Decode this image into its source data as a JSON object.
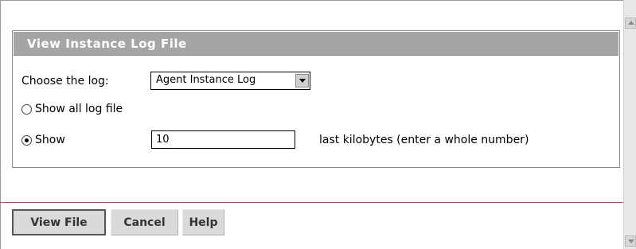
{
  "panel": {
    "title": "View Instance Log File"
  },
  "log_select": {
    "label": "Choose the log:",
    "value": "Agent Instance Log"
  },
  "options": {
    "show_all_label": "Show all log file",
    "show_all_selected": false,
    "show_last_label": "Show",
    "show_last_selected": true,
    "kilobytes_value": "10",
    "kilobytes_hint": "last kilobytes (enter a whole number)"
  },
  "buttons": {
    "view_file": "View File",
    "cancel": "Cancel",
    "help": "Help"
  }
}
